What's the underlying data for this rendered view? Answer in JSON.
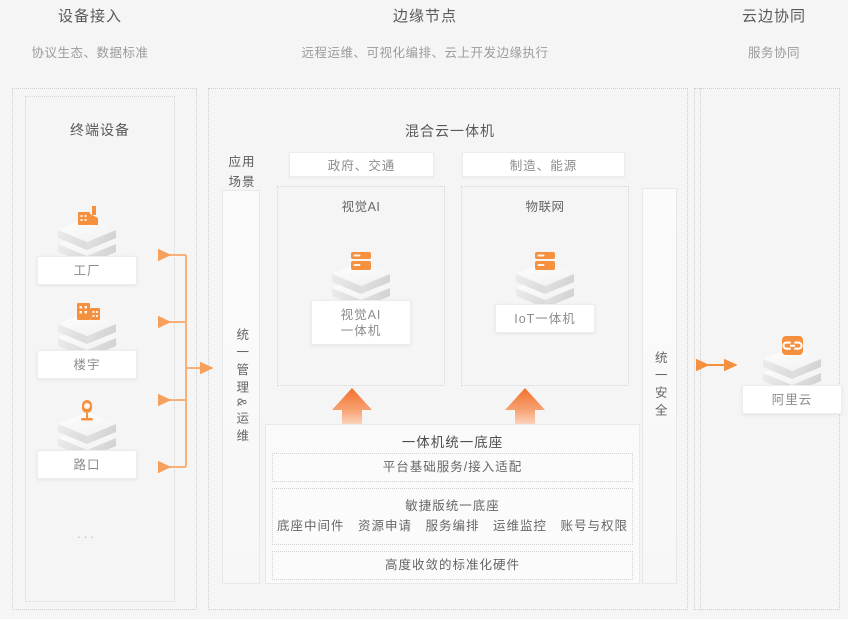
{
  "header": {
    "columns": [
      {
        "title": "设备接入",
        "subtitle": "协议生态、数据标准"
      },
      {
        "title": "边缘节点",
        "subtitle": "远程运维、可视化编排、云上开发边缘执行"
      },
      {
        "title": "云边协同",
        "subtitle": "服务协同"
      }
    ]
  },
  "device_section": {
    "title": "终端设备",
    "ellipsis": "...",
    "nodes": [
      {
        "label": "工厂",
        "icon": "factory-icon"
      },
      {
        "label": "楼宇",
        "icon": "building-icon"
      },
      {
        "label": "路口",
        "icon": "camera-icon"
      }
    ]
  },
  "edge_section": {
    "title": "混合云一体机",
    "app_scenario_label": "应用\n场景",
    "app_scenario_line1": "应用",
    "app_scenario_line2": "场景",
    "unified_mgmt_label": "统一管理&运维",
    "unified_security_label": "统一安全",
    "scenario_chips": [
      {
        "label": "政府、交通"
      },
      {
        "label": "制造、能源"
      }
    ],
    "product_groups": [
      {
        "title": "视觉AI",
        "node_label": "视觉AI\n一体机",
        "node_line1": "视觉AI",
        "node_line2": "一体机",
        "icon": "appliance-icon"
      },
      {
        "title": "物联网",
        "node_label": "IoT一体机",
        "node_line1": "IoT一体机",
        "node_line2": "",
        "icon": "appliance-icon"
      }
    ],
    "base_stack": {
      "title": "一体机统一底座",
      "rows": [
        {
          "line1": "平台基础服务/接入适配",
          "line2": ""
        },
        {
          "line1": "敏捷版统一底座",
          "line2": "底座中间件　资源申请　服务编排　运维监控　账号与权限"
        },
        {
          "line1": "高度收敛的标准化硬件",
          "line2": ""
        }
      ]
    }
  },
  "cloud_section": {
    "node": {
      "label": "阿里云",
      "icon": "alibaba-cloud-icon"
    }
  },
  "colors": {
    "accent": "#f19149",
    "accent_strong": "#f2762e",
    "background": "#f5f5f5",
    "text_primary": "#595959",
    "text_muted": "#9b9b9b",
    "border_dotted": "#cfcfcf"
  }
}
